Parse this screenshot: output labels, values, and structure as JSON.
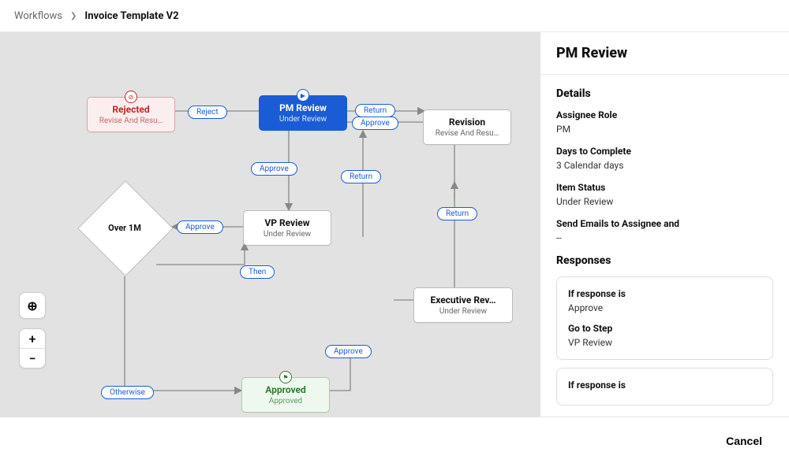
{
  "breadcrumb": {
    "root": "Workflows",
    "current": "Invoice Template V2"
  },
  "nodes": {
    "rejected": {
      "title": "Rejected",
      "sub": "Revise And Resu…"
    },
    "pm": {
      "title": "PM Review",
      "sub": "Under Review"
    },
    "revision": {
      "title": "Revision",
      "sub": "Revise And Resu…"
    },
    "vp": {
      "title": "VP Review",
      "sub": "Under Review"
    },
    "exec": {
      "title": "Executive Rev…",
      "sub": "Under Review"
    },
    "approved": {
      "title": "Approved",
      "sub": "Approved"
    }
  },
  "diamond": {
    "label": "Over 1M"
  },
  "labels": {
    "reject": "Reject",
    "approve_pm": "Approve",
    "return_pm": "Return",
    "approve_top": "Approve",
    "return_vp": "Return",
    "approve_vp": "Approve",
    "return_exec": "Return",
    "then": "Then",
    "approve_exec": "Approve",
    "otherwise": "Otherwise"
  },
  "panel": {
    "title": "PM Review",
    "details_heading": "Details",
    "assignee_k": "Assignee Role",
    "assignee_v": "PM",
    "days_k": "Days to Complete",
    "days_v": "3 Calendar days",
    "status_k": "Item Status",
    "status_v": "Under Review",
    "emails_k": "Send Emails to Assignee and",
    "emails_v": "--",
    "responses_heading": "Responses",
    "resp1_if_k": "If response is",
    "resp1_if_v": "Approve",
    "resp1_go_k": "Go to Step",
    "resp1_go_v": "VP Review",
    "resp2_if_k": "If response is"
  },
  "footer": {
    "cancel": "Cancel"
  },
  "icons": {
    "recenter": "⊕",
    "plus": "+",
    "minus": "−"
  },
  "chart_data": {
    "type": "flowchart",
    "title": "Invoice Template V2",
    "nodes": [
      {
        "id": "pm",
        "label": "PM Review",
        "status": "Under Review",
        "kind": "step",
        "selected": true
      },
      {
        "id": "rejected",
        "label": "Rejected",
        "status": "Revise And Resubmit",
        "kind": "end"
      },
      {
        "id": "revision",
        "label": "Revision",
        "status": "Revise And Resubmit",
        "kind": "step"
      },
      {
        "id": "vp",
        "label": "VP Review",
        "status": "Under Review",
        "kind": "step"
      },
      {
        "id": "over1m",
        "label": "Over 1M",
        "kind": "decision"
      },
      {
        "id": "exec",
        "label": "Executive Review",
        "status": "Under Review",
        "kind": "step"
      },
      {
        "id": "approved",
        "label": "Approved",
        "status": "Approved",
        "kind": "end"
      }
    ],
    "edges": [
      {
        "from": "pm",
        "to": "rejected",
        "label": "Reject"
      },
      {
        "from": "pm",
        "to": "vp",
        "label": "Approve"
      },
      {
        "from": "revision",
        "to": "pm",
        "label": "Return"
      },
      {
        "from": "revision",
        "to": "pm",
        "label": "Approve"
      },
      {
        "from": "vp",
        "to": "revision",
        "label": "Return"
      },
      {
        "from": "vp",
        "to": "over1m",
        "label": "Approve"
      },
      {
        "from": "over1m",
        "to": "exec",
        "label": "Then"
      },
      {
        "from": "over1m",
        "to": "approved",
        "label": "Otherwise"
      },
      {
        "from": "exec",
        "to": "revision",
        "label": "Return"
      },
      {
        "from": "exec",
        "to": "approved",
        "label": "Approve"
      }
    ]
  }
}
